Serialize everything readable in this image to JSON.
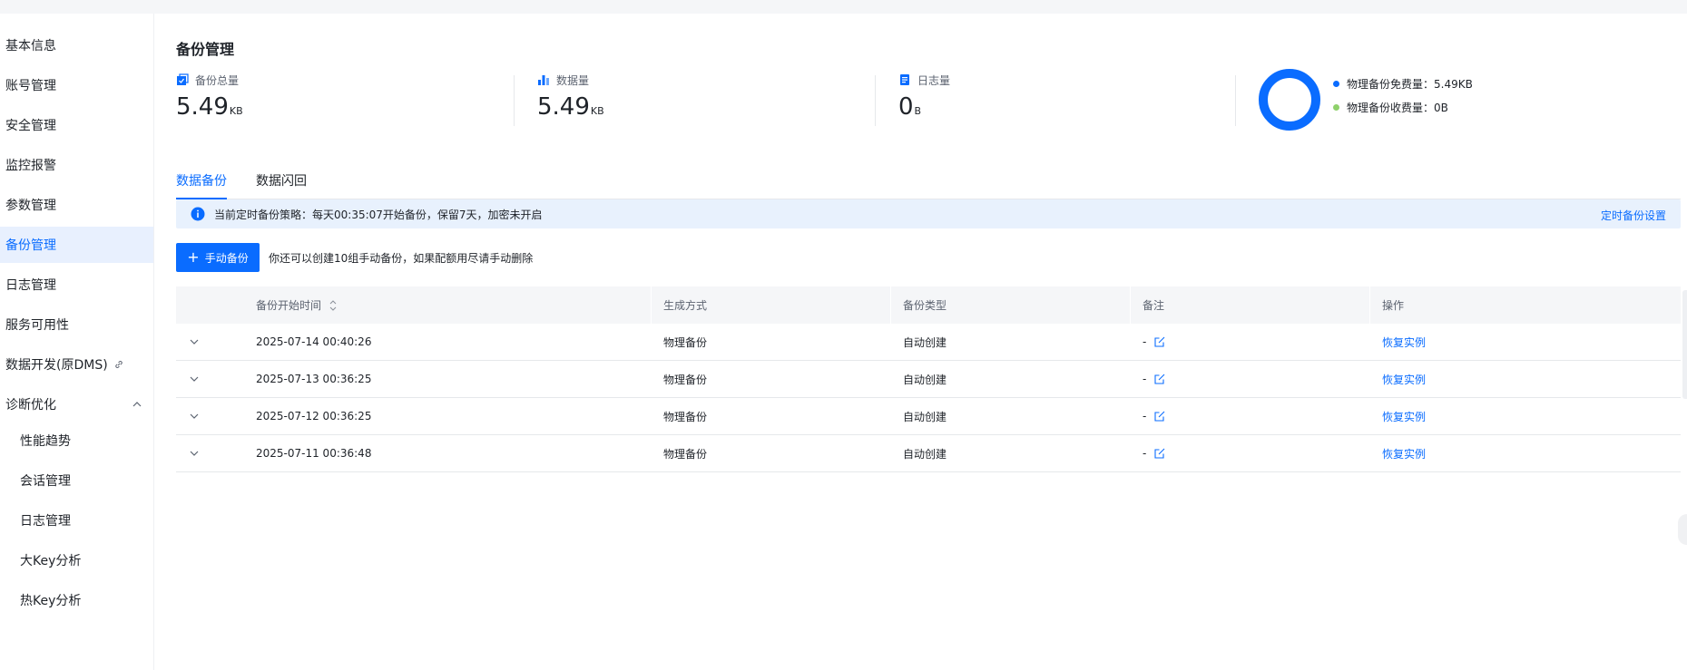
{
  "sidebar": {
    "items": [
      {
        "label": "基本信息"
      },
      {
        "label": "账号管理"
      },
      {
        "label": "安全管理"
      },
      {
        "label": "监控报警"
      },
      {
        "label": "参数管理"
      },
      {
        "label": "备份管理",
        "active": true
      },
      {
        "label": "日志管理"
      },
      {
        "label": "服务可用性"
      },
      {
        "label": "数据开发(原DMS)",
        "icon": "link-icon"
      },
      {
        "label": "诊断优化",
        "icon": "chevron-up-icon"
      }
    ],
    "subitems": [
      {
        "label": "性能趋势"
      },
      {
        "label": "会话管理"
      },
      {
        "label": "日志管理"
      },
      {
        "label": "大Key分析"
      },
      {
        "label": "热Key分析"
      }
    ]
  },
  "page": {
    "title": "备份管理"
  },
  "stats": [
    {
      "label": "备份总量",
      "value": "5.49",
      "unit": "KB",
      "icon": "backup-total-icon"
    },
    {
      "label": "数据量",
      "value": "5.49",
      "unit": "KB",
      "icon": "bar-chart-icon"
    },
    {
      "label": "日志量",
      "value": "0",
      "unit": "B",
      "icon": "log-icon"
    }
  ],
  "usage": {
    "legend": [
      {
        "label": "物理备份免费量：5.49KB",
        "color": "#0a6cff"
      },
      {
        "label": "物理备份收费量：0B",
        "color": "#8fd16b"
      }
    ],
    "free_fraction": 1.0
  },
  "tabs": [
    {
      "label": "数据备份",
      "active": true
    },
    {
      "label": "数据闪回"
    }
  ],
  "banner": {
    "text": "当前定时备份策略：每天00:35:07开始备份，保留7天，加密未开启",
    "link": "定时备份设置",
    "icon": "info-icon"
  },
  "actions": {
    "manual_backup": "手动备份",
    "hint": "你还可以创建10组手动备份，如果配额用尽请手动删除"
  },
  "table": {
    "columns": [
      "备份开始时间",
      "生成方式",
      "备份类型",
      "备注",
      "操作"
    ],
    "rows": [
      {
        "time": "2025-07-14 00:40:26",
        "method": "物理备份",
        "type": "自动创建",
        "note": "-",
        "action": "恢复实例"
      },
      {
        "time": "2025-07-13 00:36:25",
        "method": "物理备份",
        "type": "自动创建",
        "note": "-",
        "action": "恢复实例"
      },
      {
        "time": "2025-07-12 00:36:25",
        "method": "物理备份",
        "type": "自动创建",
        "note": "-",
        "action": "恢复实例"
      },
      {
        "time": "2025-07-11 00:36:48",
        "method": "物理备份",
        "type": "自动创建",
        "note": "-",
        "action": "恢复实例"
      }
    ]
  },
  "colors": {
    "accent": "#0a6cff",
    "banner_bg": "#e8f1fd",
    "header_bg": "#f5f6f8"
  }
}
